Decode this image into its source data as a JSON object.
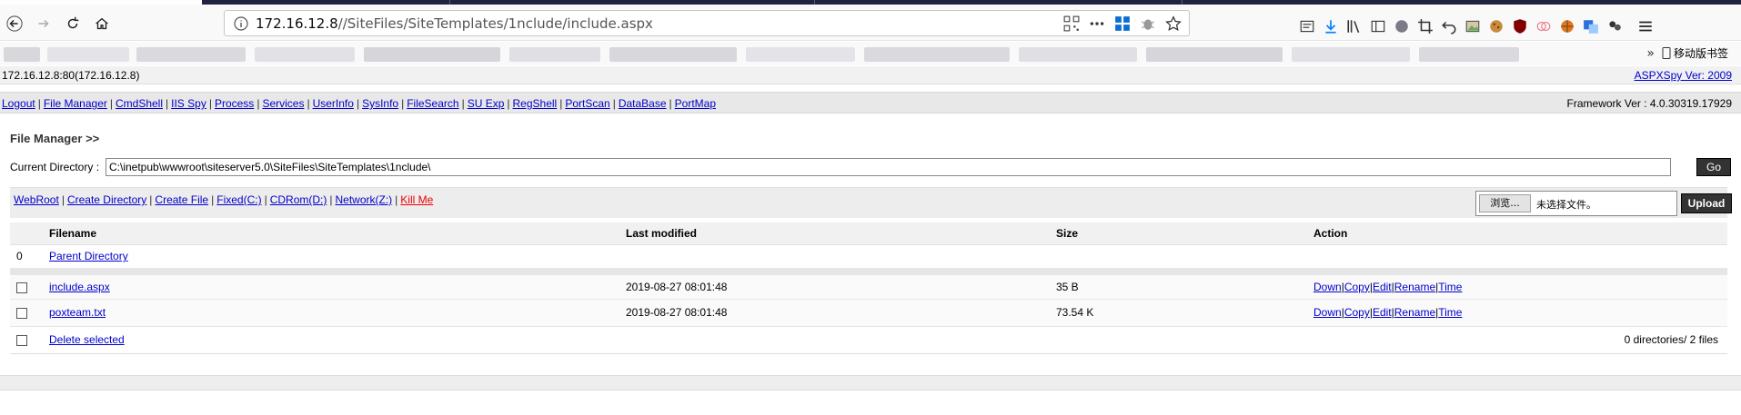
{
  "browser": {
    "url_host": "172.16.12.8",
    "url_path": "//SiteFiles/SiteTemplates/1nclude/include.aspx",
    "bookmark_folder": "移动版书签"
  },
  "header": {
    "server": "172.16.12.8:80(172.16.12.8)",
    "version_link": "ASPXSpy Ver: 2009"
  },
  "menu": {
    "items": [
      "Logout",
      "File Manager",
      "CmdShell",
      "IIS Spy",
      "Process",
      "Services",
      "UserInfo",
      "SysInfo",
      "FileSearch",
      "SU Exp",
      "RegShell",
      "PortScan",
      "DataBase",
      "PortMap"
    ],
    "framework": "Framework Ver : 4.0.30319.17929"
  },
  "file_manager": {
    "title": "File Manager >>",
    "current_dir_label": "Current Directory :",
    "current_dir_value": "C:\\inetpub\\wwwroot\\siteserver5.0\\SiteFiles\\SiteTemplates\\1nclude\\",
    "go_label": "Go",
    "quick_links": [
      "WebRoot",
      "Create Directory",
      "Create File",
      "Fixed(C:)",
      "CDRom(D:)",
      "Network(Z:)"
    ],
    "kill_label": "Kill Me",
    "browse_label": "浏览...",
    "file_status": "未选择文件。",
    "upload_label": "Upload"
  },
  "table": {
    "headers": [
      "Filename",
      "Last modified",
      "Size",
      "Action"
    ],
    "parent_index": "0",
    "parent_label": "Parent Directory",
    "rows": [
      {
        "name": "include.aspx",
        "modified": "2019-08-27 08:01:48",
        "size": "35 B"
      },
      {
        "name": "poxteam.txt",
        "modified": "2019-08-27 08:01:48",
        "size": "73.54 K"
      }
    ],
    "actions": [
      "Down",
      "Copy",
      "Edit",
      "Rename",
      "Time"
    ],
    "delete_label": "Delete selected",
    "summary": "0 directories/ 2 files"
  }
}
